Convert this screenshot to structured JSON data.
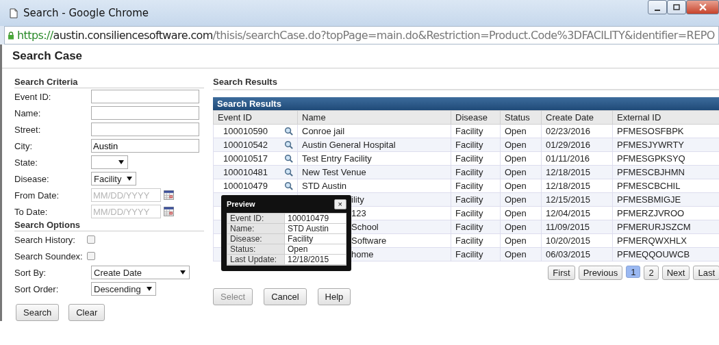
{
  "window": {
    "title": "Search - Google Chrome"
  },
  "address_bar": {
    "scheme": "https://",
    "host": "austin.consiliencesoftware.com",
    "path": "/thisis/searchCase.do?topPage=main.do&Restriction=Product.Code%3DFACILITY&identifier=REPO"
  },
  "page_title": "Search Case",
  "criteria": {
    "heading": "Search Criteria",
    "fields": [
      {
        "kind": "text",
        "label": "Event ID:"
      },
      {
        "kind": "text",
        "label": "Name:"
      },
      {
        "kind": "text",
        "label": "Street:"
      },
      {
        "kind": "text",
        "label": "City:",
        "value": "Austin"
      },
      {
        "kind": "select",
        "label": "State:"
      },
      {
        "kind": "select",
        "label": "Disease:",
        "value": "Facility"
      },
      {
        "kind": "date",
        "label": "From Date:",
        "placeholder": "MM/DD/YYYY"
      },
      {
        "kind": "date",
        "label": "To Date:",
        "placeholder": "MM/DD/YYYY"
      }
    ]
  },
  "options": {
    "heading": "Search Options",
    "fields": [
      {
        "kind": "checkbox",
        "label": "Search History:",
        "checked": false
      },
      {
        "kind": "checkbox",
        "label": "Search Soundex:",
        "checked": false
      },
      {
        "kind": "select",
        "label": "Sort By:",
        "value": "Create Date",
        "wide": true
      },
      {
        "kind": "select",
        "label": "Sort Order:",
        "value": "Descending",
        "wide": false
      }
    ]
  },
  "form_buttons": [
    "Search",
    "Clear"
  ],
  "results": {
    "heading": "Search Results",
    "panel_title": "Search Results",
    "columns": [
      "Event ID",
      "Name",
      "Disease",
      "Status",
      "Create Date",
      "External ID"
    ],
    "rows": [
      {
        "kind": "full",
        "event_id": "100010590",
        "name": "Conroe jail",
        "disease": "Facility",
        "status": "Open",
        "create_date": "02/23/2016",
        "external_id": "PFMESOSFBPK"
      },
      {
        "kind": "full",
        "event_id": "100010542",
        "name": "Austin General Hospital",
        "disease": "Facility",
        "status": "Open",
        "create_date": "01/29/2016",
        "external_id": "PFMESJYWRTY"
      },
      {
        "kind": "full",
        "event_id": "100010517",
        "name": "Test Entry Facility",
        "disease": "Facility",
        "status": "Open",
        "create_date": "01/11/2016",
        "external_id": "PFMESGPKSYQ"
      },
      {
        "kind": "full",
        "event_id": "100010481",
        "name": "New Test Venue",
        "disease": "Facility",
        "status": "Open",
        "create_date": "12/18/2015",
        "external_id": "PFMESCBJHMN"
      },
      {
        "kind": "full",
        "event_id": "100010479",
        "name": "STD Austin",
        "disease": "Facility",
        "status": "Open",
        "create_date": "12/18/2015",
        "external_id": "PFMESCBCHIL"
      },
      {
        "kind": "covered",
        "name": "ility",
        "disease": "Facility",
        "status": "Open",
        "create_date": "12/15/2015",
        "external_id": "PFMESBMIGJE"
      },
      {
        "kind": "covered",
        "name": "123",
        "disease": "Facility",
        "status": "Open",
        "create_date": "12/04/2015",
        "external_id": "PFMERZJVROO"
      },
      {
        "kind": "covered",
        "name": "School",
        "disease": "Facility",
        "status": "Open",
        "create_date": "11/09/2015",
        "external_id": "PFMERURJSZCM"
      },
      {
        "kind": "covered",
        "name": "Software",
        "disease": "Facility",
        "status": "Open",
        "create_date": "10/20/2015",
        "external_id": "PFMERQWXHLX"
      },
      {
        "kind": "covered",
        "name": "home",
        "disease": "Facility",
        "status": "Open",
        "create_date": "06/03/2015",
        "external_id": "PFMEQQOUWCB"
      }
    ],
    "pager": [
      {
        "label": "First",
        "selected": false
      },
      {
        "label": "Previous",
        "selected": false
      },
      {
        "label": "1",
        "selected": true
      },
      {
        "label": "2",
        "selected": false
      },
      {
        "label": "Next",
        "selected": false
      },
      {
        "label": "Last",
        "selected": false
      }
    ],
    "buttons": [
      {
        "label": "Select",
        "disabled": true
      },
      {
        "label": "Cancel",
        "disabled": false
      },
      {
        "label": "Help",
        "disabled": false
      }
    ]
  },
  "preview": {
    "title": "Preview",
    "close": "×",
    "fields": [
      {
        "label": "Event ID:",
        "value": "100010479"
      },
      {
        "label": "Name:",
        "value": "STD Austin"
      },
      {
        "label": "Disease:",
        "value": "Facility"
      },
      {
        "label": "Status:",
        "value": "Open"
      },
      {
        "label": "Last Update:",
        "value": "12/18/2015"
      }
    ]
  }
}
